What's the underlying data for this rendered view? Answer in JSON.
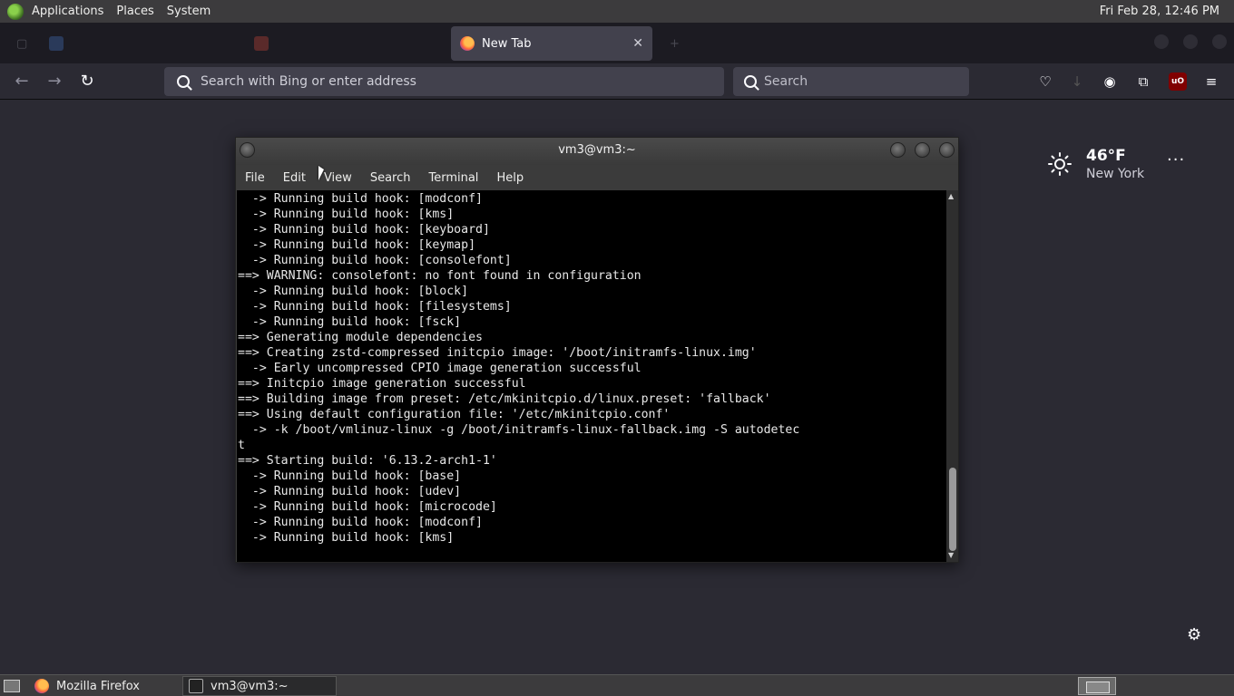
{
  "top_panel": {
    "menus": [
      "Applications",
      "Places",
      "System"
    ],
    "clock": "Fri Feb 28, 12:46 PM"
  },
  "browser": {
    "tabs": [
      {
        "label": "",
        "active": false
      },
      {
        "label": "",
        "active": false
      },
      {
        "label": "New Tab",
        "active": true
      }
    ],
    "url_placeholder": "Search with Bing or enter address",
    "search_placeholder": "Search"
  },
  "weather": {
    "temperature": "46°F",
    "city": "New York",
    "more": "···"
  },
  "terminal": {
    "title": "vm3@vm3:~",
    "menus": [
      "File",
      "Edit",
      "View",
      "Search",
      "Terminal",
      "Help"
    ],
    "lines": [
      "  -> Running build hook: [modconf]",
      "  -> Running build hook: [kms]",
      "  -> Running build hook: [keyboard]",
      "  -> Running build hook: [keymap]",
      "  -> Running build hook: [consolefont]",
      "==> WARNING: consolefont: no font found in configuration",
      "  -> Running build hook: [block]",
      "  -> Running build hook: [filesystems]",
      "  -> Running build hook: [fsck]",
      "==> Generating module dependencies",
      "==> Creating zstd-compressed initcpio image: '/boot/initramfs-linux.img'",
      "  -> Early uncompressed CPIO image generation successful",
      "==> Initcpio image generation successful",
      "==> Building image from preset: /etc/mkinitcpio.d/linux.preset: 'fallback'",
      "==> Using default configuration file: '/etc/mkinitcpio.conf'",
      "  -> -k /boot/vmlinuz-linux -g /boot/initramfs-linux-fallback.img -S autodetec",
      "t",
      "==> Starting build: '6.13.2-arch1-1'",
      "  -> Running build hook: [base]",
      "  -> Running build hook: [udev]",
      "  -> Running build hook: [microcode]",
      "  -> Running build hook: [modconf]",
      "  -> Running build hook: [kms]"
    ]
  },
  "taskbar": {
    "tasks": [
      "Mozilla Firefox",
      "vm3@vm3:~"
    ]
  }
}
